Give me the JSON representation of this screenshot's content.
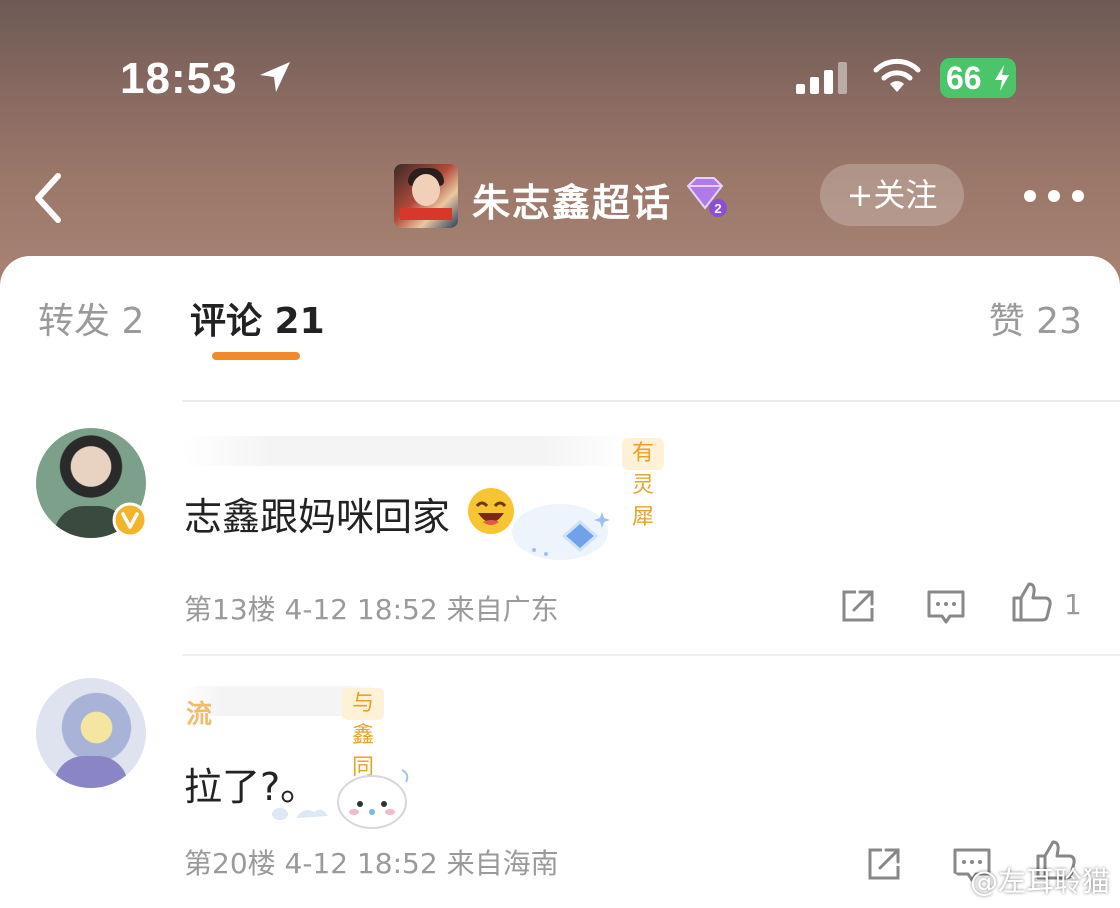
{
  "status_bar": {
    "time": "18:53",
    "battery": "66",
    "icons": [
      "location-arrow-icon",
      "signal-icon",
      "wifi-icon",
      "battery-charging-icon"
    ]
  },
  "nav": {
    "title": "朱志鑫超话",
    "follow_label": "+关注",
    "level_badge": "2",
    "icons": [
      "back-chevron-icon",
      "diamond-level-icon",
      "more-icon"
    ]
  },
  "tabs": [
    {
      "label": "转发 2"
    },
    {
      "label": "评论 21"
    },
    {
      "label": "赞 23"
    }
  ],
  "accent_color": "#f08a2a",
  "comments": [
    {
      "badge": "有灵犀",
      "text": "志鑫跟妈咪回家",
      "meta": "第13楼 4-12 18:52 来自广东",
      "likes": "1"
    },
    {
      "name_fragment": "流",
      "badge": "与鑫同行",
      "text": "拉了?。",
      "meta": "第20楼 4-12 18:52 来自海南",
      "likes": ""
    }
  ],
  "watermark": "@左耳聆猫"
}
